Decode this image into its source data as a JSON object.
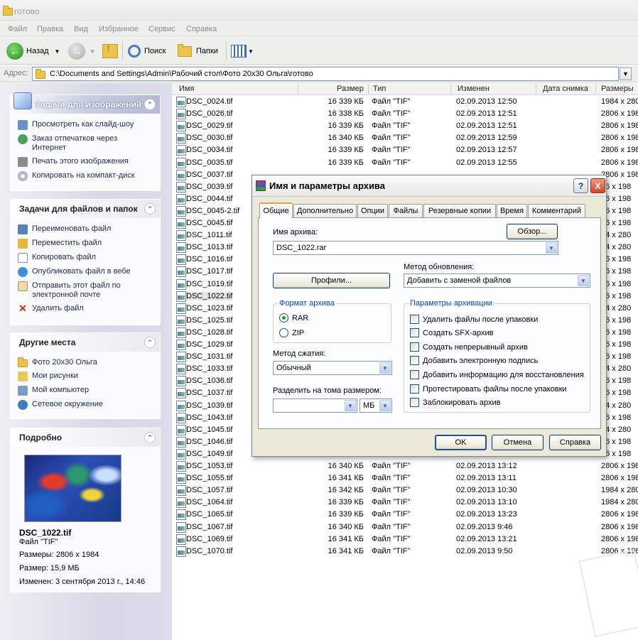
{
  "window": {
    "title": "готово"
  },
  "menu": [
    "Файл",
    "Правка",
    "Вид",
    "Избранное",
    "Сервис",
    "Справка"
  ],
  "toolbar": {
    "back": "Назад",
    "search": "Поиск",
    "folders": "Папки"
  },
  "address": {
    "label": "Адрес:",
    "path": "C:\\Documents and Settings\\Admin\\Рабочий стол\\Фото 20x30 Ольга\\готово"
  },
  "sidebar": {
    "image_tasks": {
      "title": "Задачи для изображений",
      "items": [
        "Просмотреть как слайд-шоу",
        "Заказ отпечатков через Интернет",
        "Печать этого изображения",
        "Копировать на компакт-диск"
      ]
    },
    "file_tasks": {
      "title": "Задачи для файлов и папок",
      "items": [
        "Переименовать файл",
        "Переместить файл",
        "Копировать файл",
        "Опубликовать файл в вебе",
        "Отправить этот файл по электронной почте",
        "Удалить файл"
      ]
    },
    "other_places": {
      "title": "Другие места",
      "items": [
        "Фото 20x30 Ольга",
        "Мои рисунки",
        "Мой компьютер",
        "Сетевое окружение"
      ]
    },
    "details": {
      "title": "Подробно",
      "filename": "DSC_1022.tif",
      "filetype": "Файл \"TIF\"",
      "dimensions": "Размеры: 2806 x 1984",
      "size": "Размер: 15,9 МБ",
      "modified": "Изменен: 3 сентября 2013 г., 14:46"
    }
  },
  "columns": [
    "Имя",
    "Размер",
    "Тип",
    "Изменен",
    "Дата снимка",
    "Размеры"
  ],
  "files": [
    {
      "name": "DSC_0024.tif",
      "size": "16 339 КБ",
      "type": "Файл \"TIF\"",
      "modified": "02.09.2013 12:50",
      "dims": "1984 x 280"
    },
    {
      "name": "DSC_0026.tif",
      "size": "16 338 КБ",
      "type": "Файл \"TIF\"",
      "modified": "02.09.2013 12:51",
      "dims": "2806 x 198"
    },
    {
      "name": "DSC_0029.tif",
      "size": "16 339 КБ",
      "type": "Файл \"TIF\"",
      "modified": "02.09.2013 12:51",
      "dims": "2806 x 198"
    },
    {
      "name": "DSC_0030.tif",
      "size": "16 340 КБ",
      "type": "Файл \"TIF\"",
      "modified": "02.09.2013 12:59",
      "dims": "2806 x 198"
    },
    {
      "name": "DSC_0034.tif",
      "size": "16 339 КБ",
      "type": "Файл \"TIF\"",
      "modified": "02.09.2013 12:57",
      "dims": "2806 x 198"
    },
    {
      "name": "DSC_0035.tif",
      "size": "16 339 КБ",
      "type": "Файл \"TIF\"",
      "modified": "02.09.2013 12:55",
      "dims": "2806 x 198"
    },
    {
      "name": "DSC_0037.tif",
      "size": "",
      "type": "",
      "modified": "",
      "dims": "2806 x 198"
    },
    {
      "name": "DSC_0039.tif",
      "size": "",
      "type": "",
      "modified": "",
      "dims": "06 x 198"
    },
    {
      "name": "DSC_0044.tif",
      "size": "",
      "type": "",
      "modified": "",
      "dims": "06 x 198"
    },
    {
      "name": "DSC_0045-2.tif",
      "size": "",
      "type": "",
      "modified": "",
      "dims": "06 x 198"
    },
    {
      "name": "DSC_0045.tif",
      "size": "",
      "type": "",
      "modified": "",
      "dims": "06 x 198"
    },
    {
      "name": "DSC_1011.tif",
      "size": "",
      "type": "",
      "modified": "",
      "dims": "84 x 280"
    },
    {
      "name": "DSC_1013.tif",
      "size": "",
      "type": "",
      "modified": "",
      "dims": "84 x 280"
    },
    {
      "name": "DSC_1016.tif",
      "size": "",
      "type": "",
      "modified": "",
      "dims": "06 x 198"
    },
    {
      "name": "DSC_1017.tif",
      "size": "",
      "type": "",
      "modified": "",
      "dims": "06 x 198"
    },
    {
      "name": "DSC_1019.tif",
      "size": "",
      "type": "",
      "modified": "",
      "dims": "06 x 198"
    },
    {
      "name": "DSC_1022.tif",
      "size": "",
      "type": "",
      "modified": "",
      "dims": "06 x 198"
    },
    {
      "name": "DSC_1023.tif",
      "size": "",
      "type": "",
      "modified": "",
      "dims": "84 x 280"
    },
    {
      "name": "DSC_1025.tif",
      "size": "",
      "type": "",
      "modified": "",
      "dims": "06 x 198"
    },
    {
      "name": "DSC_1028.tif",
      "size": "",
      "type": "",
      "modified": "",
      "dims": "06 x 198"
    },
    {
      "name": "DSC_1029.tif",
      "size": "",
      "type": "",
      "modified": "",
      "dims": "06 x 198"
    },
    {
      "name": "DSC_1031.tif",
      "size": "",
      "type": "",
      "modified": "",
      "dims": "06 x 198"
    },
    {
      "name": "DSC_1033.tif",
      "size": "",
      "type": "",
      "modified": "",
      "dims": "84 x 280"
    },
    {
      "name": "DSC_1036.tif",
      "size": "",
      "type": "",
      "modified": "",
      "dims": "06 x 198"
    },
    {
      "name": "DSC_1037.tif",
      "size": "",
      "type": "",
      "modified": "",
      "dims": "06 x 198"
    },
    {
      "name": "DSC_1039.tif",
      "size": "",
      "type": "",
      "modified": "",
      "dims": "84 x 280"
    },
    {
      "name": "DSC_1043.tif",
      "size": "",
      "type": "",
      "modified": "",
      "dims": "06 x 198"
    },
    {
      "name": "DSC_1045.tif",
      "size": "",
      "type": "",
      "modified": "",
      "dims": "84 x 280"
    },
    {
      "name": "DSC_1046.tif",
      "size": "",
      "type": "",
      "modified": "",
      "dims": "06 x 198"
    },
    {
      "name": "DSC_1049.tif",
      "size": "",
      "type": "",
      "modified": "",
      "dims": "06 x 198"
    },
    {
      "name": "DSC_1053.tif",
      "size": "16 340 КБ",
      "type": "Файл \"TIF\"",
      "modified": "02.09.2013 13:12",
      "dims": "2806 x 198"
    },
    {
      "name": "DSC_1055.tif",
      "size": "16 341 КБ",
      "type": "Файл \"TIF\"",
      "modified": "02.09.2013 13:11",
      "dims": "2806 x 198"
    },
    {
      "name": "DSC_1057.tif",
      "size": "16 342 КБ",
      "type": "Файл \"TIF\"",
      "modified": "02.09.2013 10:30",
      "dims": "1984 x 280"
    },
    {
      "name": "DSC_1064.tif",
      "size": "16 339 КБ",
      "type": "Файл \"TIF\"",
      "modified": "02.09.2013 13:10",
      "dims": "1984 x 280"
    },
    {
      "name": "DSC_1065.tif",
      "size": "16 339 КБ",
      "type": "Файл \"TIF\"",
      "modified": "02.09.2013 13:23",
      "dims": "2806 x 198"
    },
    {
      "name": "DSC_1067.tif",
      "size": "16 340 КБ",
      "type": "Файл \"TIF\"",
      "modified": "02.09.2013 9:46",
      "dims": "2806 x 198"
    },
    {
      "name": "DSC_1069.tif",
      "size": "16 341 КБ",
      "type": "Файл \"TIF\"",
      "modified": "02.09.2013 13:21",
      "dims": "2806 x 198"
    },
    {
      "name": "DSC_1070.tif",
      "size": "16 341 КБ",
      "type": "Файл \"TIF\"",
      "modified": "02.09.2013 9:50",
      "dims": "2806 x 198"
    }
  ],
  "dialog": {
    "title": "Имя и параметры архива",
    "tabs": [
      "Общие",
      "Дополнительно",
      "Опции",
      "Файлы",
      "Резервные копии",
      "Время",
      "Комментарий"
    ],
    "archive_name_label": "Имя архива:",
    "archive_name": "DSC_1022.rar",
    "browse": "Обзор...",
    "profiles": "Профили...",
    "update_method_label": "Метод обновления:",
    "update_method": "Добавить с заменой файлов",
    "format_group": "Формат архива",
    "format_rar": "RAR",
    "format_zip": "ZIP",
    "compression_label": "Метод сжатия:",
    "compression": "Обычный",
    "split_label": "Разделить на тома размером:",
    "split_value": "",
    "split_unit": "МБ",
    "params_group": "Параметры архивации",
    "options": [
      "Удалить файлы после упаковки",
      "Создать SFX-архив",
      "Создать непрерывный архив",
      "Добавить электронную подпись",
      "Добавить информацию для восстановления",
      "Протестировать файлы после упаковки",
      "Заблокировать архив"
    ],
    "ok": "OK",
    "cancel": "Отмена",
    "help": "Справка",
    "help_icon": "?",
    "close_icon": "X"
  }
}
